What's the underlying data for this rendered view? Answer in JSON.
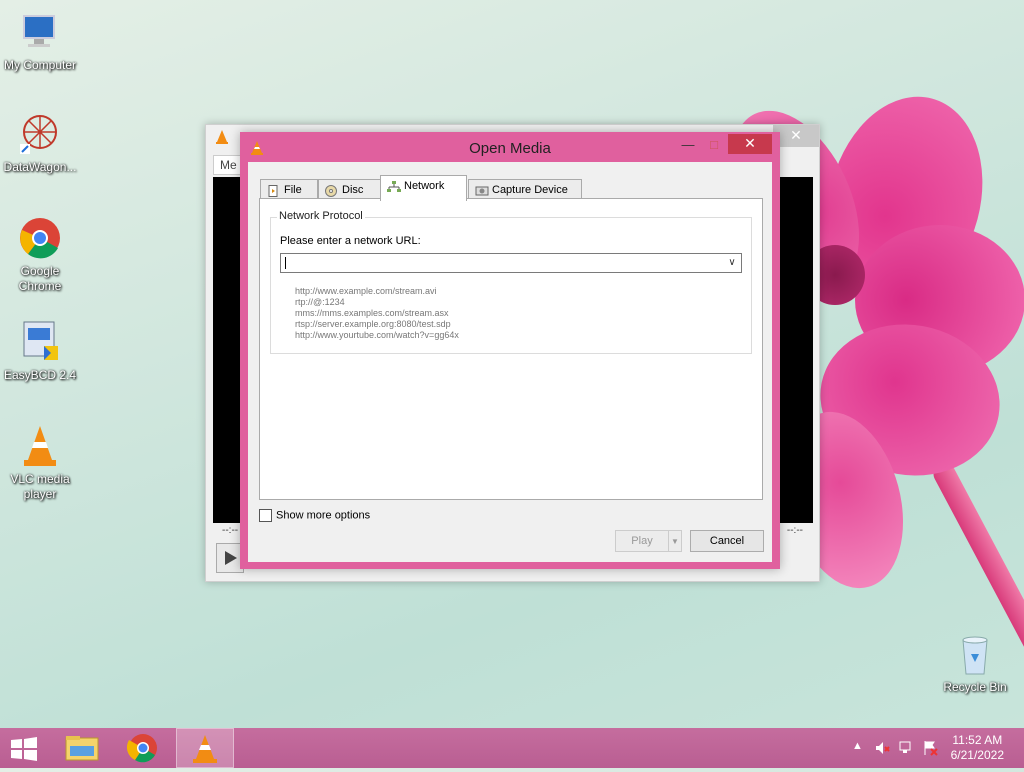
{
  "desktop": {
    "icons": [
      {
        "label": "My Computer"
      },
      {
        "label": "DataWagon..."
      },
      {
        "label": "Google Chrome"
      },
      {
        "label": "EasyBCD 2.4"
      },
      {
        "label": "VLC media player"
      },
      {
        "label": "Recycle Bin"
      }
    ]
  },
  "vlc_main": {
    "menu_partial": "Me",
    "time_left": "--:--",
    "time_right": "--:--"
  },
  "dialog": {
    "title": "Open Media",
    "tabs": [
      {
        "label": "File",
        "icon": "file-icon"
      },
      {
        "label": "Disc",
        "icon": "disc-icon"
      },
      {
        "label": "Network",
        "icon": "network-icon",
        "active": true
      },
      {
        "label": "Capture Device",
        "icon": "capture-device-icon"
      }
    ],
    "group_label": "Network Protocol",
    "url_label": "Please enter a network URL:",
    "url_value": "",
    "examples": [
      "http://www.example.com/stream.avi",
      "rtp://@:1234",
      "mms://mms.examples.com/stream.asx",
      "rtsp://server.example.org:8080/test.sdp",
      "http://www.yourtube.com/watch?v=gg64x"
    ],
    "show_more_options": "Show more options",
    "show_more_checked": false,
    "play_label": "Play",
    "cancel_label": "Cancel"
  },
  "taskbar": {
    "time": "11:52 AM",
    "date": "6/21/2022"
  },
  "colors": {
    "dialog_frame": "#e0609e",
    "close_button": "#c7394d",
    "taskbar": "#c56d9e"
  }
}
